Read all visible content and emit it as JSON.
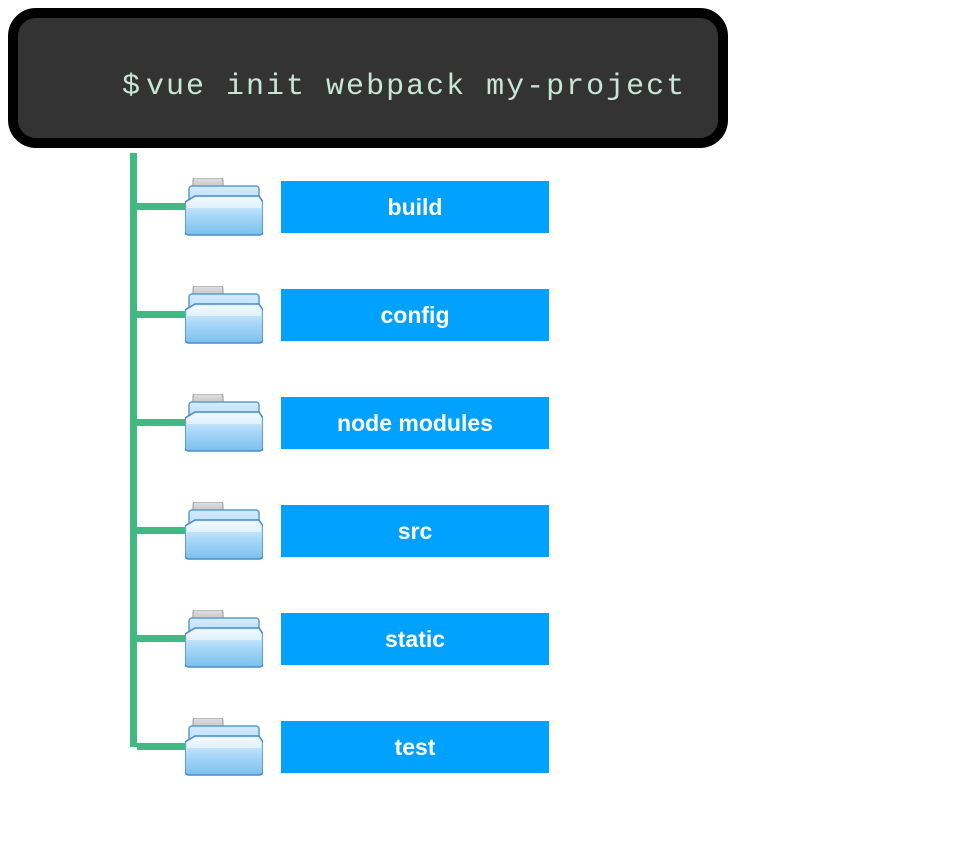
{
  "terminal": {
    "prompt": "$",
    "command": "vue init webpack my-project"
  },
  "folders": [
    {
      "label": "build"
    },
    {
      "label": "config"
    },
    {
      "label": "node modules"
    },
    {
      "label": "src"
    },
    {
      "label": "static"
    },
    {
      "label": "test"
    }
  ],
  "colors": {
    "terminal_bg": "#333333",
    "terminal_border": "#000000",
    "terminal_text": "#c8e6d8",
    "tree_line": "#42b883",
    "label_bg": "#00a1ff",
    "label_text": "#ffffff"
  }
}
